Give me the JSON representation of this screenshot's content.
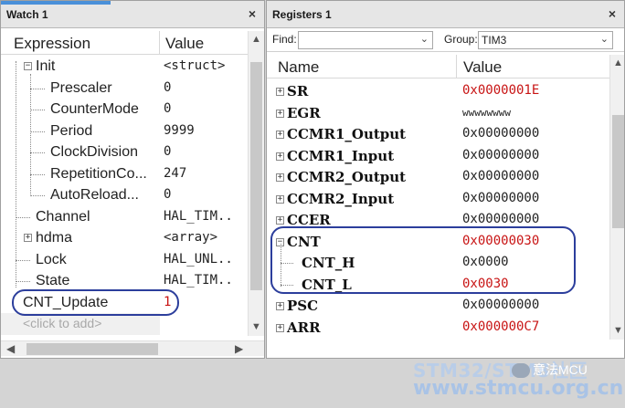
{
  "watch": {
    "title": "Watch 1",
    "close": "×",
    "col_expression": "Expression",
    "col_value": "Value",
    "rows": [
      {
        "name": "Init",
        "value": "<struct>",
        "expander": "−"
      },
      {
        "name": "Prescaler",
        "value": "0"
      },
      {
        "name": "CounterMode",
        "value": "0"
      },
      {
        "name": "Period",
        "value": "9999"
      },
      {
        "name": "ClockDivision",
        "value": "0"
      },
      {
        "name": "RepetitionCo...",
        "value": "247"
      },
      {
        "name": "AutoReload...",
        "value": "0"
      },
      {
        "name": "Channel",
        "value": "HAL_TIM.."
      },
      {
        "name": "hdma",
        "value": "<array>",
        "expander": "+"
      },
      {
        "name": "Lock",
        "value": "HAL_UNL.."
      },
      {
        "name": "State",
        "value": "HAL_TIM.."
      },
      {
        "name": "CNT_Update",
        "value": "1"
      },
      {
        "name": "<click to add>",
        "value": ""
      }
    ]
  },
  "registers": {
    "title": "Registers 1",
    "close": "×",
    "find_label": "Find:",
    "find_value": "",
    "group_label": "Group:",
    "group_value": "TIM3",
    "col_name": "Name",
    "col_value": "Value",
    "rows": [
      {
        "name": "SR",
        "value": "0x0000001E",
        "expander": "+",
        "red": true
      },
      {
        "name": "EGR",
        "value": "wwwwwwww",
        "expander": "+"
      },
      {
        "name": "CCMR1_Output",
        "value": "0x00000000",
        "expander": "+"
      },
      {
        "name": "CCMR1_Input",
        "value": "0x00000000",
        "expander": "+"
      },
      {
        "name": "CCMR2_Output",
        "value": "0x00000000",
        "expander": "+"
      },
      {
        "name": "CCMR2_Input",
        "value": "0x00000000",
        "expander": "+"
      },
      {
        "name": "CCER",
        "value": "0x00000000",
        "expander": "+"
      },
      {
        "name": "CNT",
        "value": "0x00000030",
        "expander": "−",
        "red": true
      },
      {
        "name": "CNT_H",
        "value": "0x0000",
        "child": true
      },
      {
        "name": "CNT_L",
        "value": "0x0030",
        "child": true,
        "red": true
      },
      {
        "name": "PSC",
        "value": "0x00000000",
        "expander": "+"
      },
      {
        "name": "ARR",
        "value": "0x000000C7",
        "expander": "+",
        "red": true
      }
    ]
  },
  "watermark": {
    "line1": "STM32/STM8社区",
    "line2": "www.stmcu.org.cn",
    "wechat": "意法MCU"
  },
  "colors": {
    "highlight_oval": "#2c3e9c",
    "changed_value": "#c81414"
  }
}
